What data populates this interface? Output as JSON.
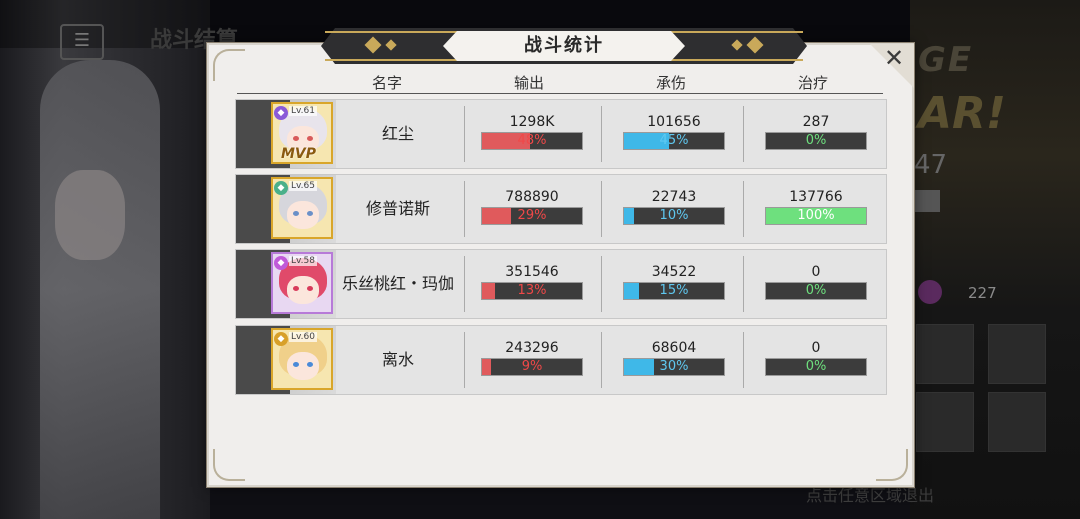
{
  "background": {
    "title": "战斗结算",
    "stage_text": "GE",
    "clear_text": "AR!",
    "side_number": "47",
    "side_value": "227",
    "exit_hint": "点击任意区域退出"
  },
  "dialog": {
    "title": "战斗统计",
    "close_icon": "close-icon",
    "headers": {
      "name": "名字",
      "damage": "输出",
      "taken": "承伤",
      "heal": "治疗"
    },
    "rows": [
      {
        "name": "红尘",
        "level": "Lv.61",
        "mvp": "MVP",
        "frame": "gold",
        "class_color": "#8a5ad8",
        "hair": "#e8e4ec",
        "eye": "#d85a5a",
        "damage": "1298K",
        "damage_pct": "48%",
        "damage_frac": 0.48,
        "taken": "101656",
        "taken_pct": "45%",
        "taken_frac": 0.45,
        "heal": "287",
        "heal_pct": "0%",
        "heal_frac": 0.0
      },
      {
        "name": "修普诺斯",
        "level": "Lv.65",
        "mvp": "",
        "frame": "gold",
        "class_color": "#4ab08a",
        "hair": "#d6d6dc",
        "eye": "#6a90c8",
        "damage": "788890",
        "damage_pct": "29%",
        "damage_frac": 0.29,
        "taken": "22743",
        "taken_pct": "10%",
        "taken_frac": 0.1,
        "heal": "137766",
        "heal_pct": "100%",
        "heal_frac": 1.0
      },
      {
        "name": "乐丝桃红・玛伽",
        "level": "Lv.58",
        "mvp": "",
        "frame": "purple",
        "class_color": "#c05ad8",
        "hair": "#e04a6a",
        "eye": "#d83a5a",
        "damage": "351546",
        "damage_pct": "13%",
        "damage_frac": 0.13,
        "taken": "34522",
        "taken_pct": "15%",
        "taken_frac": 0.15,
        "heal": "0",
        "heal_pct": "0%",
        "heal_frac": 0.0
      },
      {
        "name": "离水",
        "level": "Lv.60",
        "mvp": "",
        "frame": "gold",
        "class_color": "#d8a02a",
        "hair": "#f0d08a",
        "eye": "#4a8ad8",
        "damage": "243296",
        "damage_pct": "9%",
        "damage_frac": 0.09,
        "taken": "68604",
        "taken_pct": "30%",
        "taken_frac": 0.3,
        "heal": "0",
        "heal_pct": "0%",
        "heal_frac": 0.0
      }
    ]
  },
  "colors": {
    "damage": "#e05a5c",
    "taken": "#3fb8e8",
    "heal": "#6ee07e",
    "gold": "#c9a95a"
  }
}
